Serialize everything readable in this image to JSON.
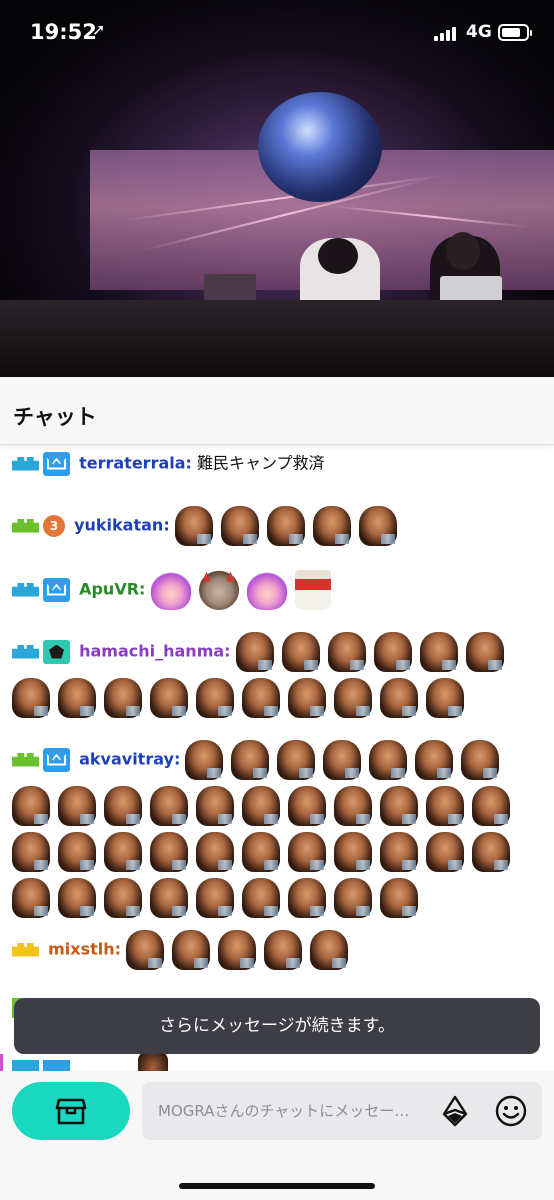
{
  "status_bar": {
    "time": "19:52",
    "network": "4G",
    "location_glyph": "➚"
  },
  "video": {
    "description_icon": "live-video"
  },
  "chat": {
    "title": "チャット",
    "messages": [
      {
        "username": "terraterrala",
        "suffix": ":",
        "color": "#1f3fb8",
        "text": "難民キャンプ救済",
        "emote_rows": []
      },
      {
        "username": "yukikatan",
        "suffix": ":",
        "color": "#1f3fb8",
        "text": "",
        "badge_number": "3"
      },
      {
        "username": "ApuVR",
        "suffix": ":",
        "color": "#2a8a2a",
        "text": ""
      },
      {
        "username": "hamachi_hanma",
        "suffix": ":",
        "color": "#8a3cc4",
        "text": ""
      },
      {
        "username": "akvavitray",
        "suffix": ":",
        "color": "#1f3fb8",
        "text": ""
      },
      {
        "username": "mixstlh",
        "suffix": ":",
        "color": "#c45a12",
        "text": ""
      }
    ],
    "more_messages_toast": "さらにメッセージが続きます。"
  },
  "input": {
    "placeholder": "MOGRAさんのチャットにメッセー…"
  },
  "colors": {
    "accent": "#19d8bf",
    "toast_bg": "#3d3e45",
    "bits_badge_blue": "#2aa6d8",
    "bits_badge_green": "#6ac12b",
    "bits_badge_yellow": "#f0c419"
  }
}
